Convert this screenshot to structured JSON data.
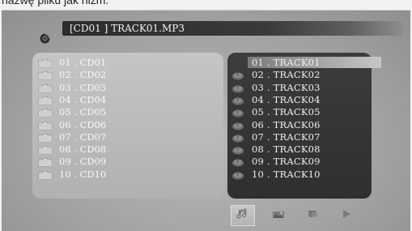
{
  "caption": "nazwę pliku jak niżm.",
  "header": {
    "current_file": "[CD01 ] TRACK01.MP3",
    "icon": "disc-icon"
  },
  "folders": [
    {
      "label": "01 . CD01",
      "icon": "folder-icon"
    },
    {
      "label": "02 . CD02",
      "icon": "folder-icon"
    },
    {
      "label": "03 . CD03",
      "icon": "folder-icon"
    },
    {
      "label": "04 . CD04",
      "icon": "folder-icon"
    },
    {
      "label": "05 . CD05",
      "icon": "folder-icon"
    },
    {
      "label": "06 . CD06",
      "icon": "folder-icon"
    },
    {
      "label": "07 . CD07",
      "icon": "folder-icon"
    },
    {
      "label": "08 . CD08",
      "icon": "folder-icon"
    },
    {
      "label": "09 . CD09",
      "icon": "folder-icon"
    },
    {
      "label": "10 . CD10",
      "icon": "folder-icon"
    }
  ],
  "tracks": [
    {
      "label": "01 .  TRACK01",
      "selected": true,
      "icon": "music-file-icon"
    },
    {
      "label": "02 .  TRACK02",
      "selected": false,
      "icon": "music-file-icon"
    },
    {
      "label": "03 .  TRACK03",
      "selected": false,
      "icon": "music-file-icon"
    },
    {
      "label": "04 .  TRACK04",
      "selected": false,
      "icon": "music-file-icon"
    },
    {
      "label": "05 .  TRACK05",
      "selected": false,
      "icon": "music-file-icon"
    },
    {
      "label": "06 .  TRACK06",
      "selected": false,
      "icon": "music-file-icon"
    },
    {
      "label": "07 .  TRACK07",
      "selected": false,
      "icon": "music-file-icon"
    },
    {
      "label": "08 .  TRACK08",
      "selected": false,
      "icon": "music-file-icon"
    },
    {
      "label": "09 .  TRACK09",
      "selected": false,
      "icon": "music-file-icon"
    },
    {
      "label": "10 .  TRACK10",
      "selected": false,
      "icon": "music-file-icon"
    }
  ],
  "tabs": [
    {
      "icon": "music-note-icon",
      "active": true
    },
    {
      "icon": "photo-icon",
      "active": false
    },
    {
      "icon": "video-icon",
      "active": false
    },
    {
      "icon": "play-icon",
      "active": false
    }
  ],
  "colors": {
    "background": "#a2a2a2",
    "left_panel": "#bdbdbd",
    "right_panel": "#353535",
    "highlight": "#9a9a9a",
    "text_light": "#f2f2f2"
  }
}
